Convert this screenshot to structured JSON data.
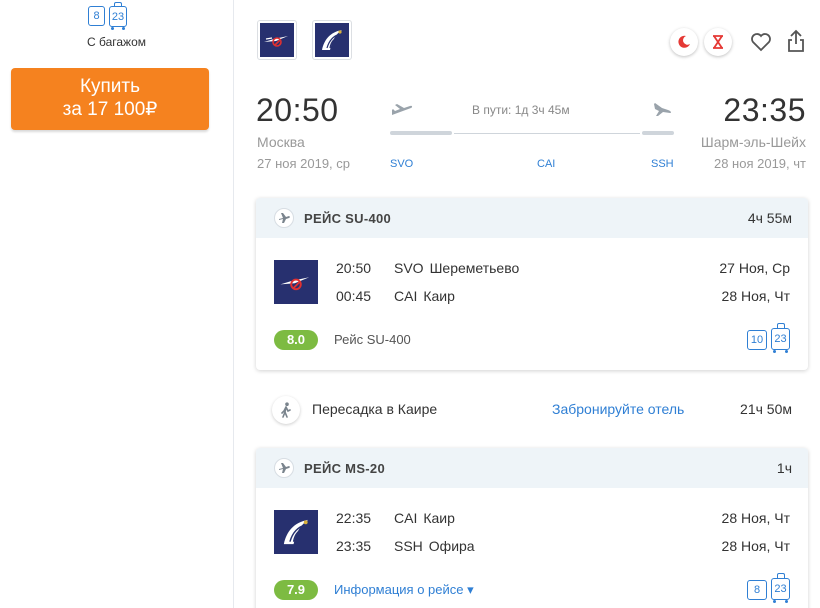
{
  "sidebar": {
    "bag_icons": [
      {
        "value": "8",
        "type": "hand-luggage"
      },
      {
        "value": "23",
        "type": "checked-luggage"
      }
    ],
    "bag_label": "С багажом",
    "buy_line1": "Купить",
    "buy_line2": "за 17 100₽",
    "accent_color": "#f5821f"
  },
  "header": {
    "airline_logos": [
      "aeroflot-logo",
      "egyptair-logo"
    ],
    "icons": [
      "night-flight-icon",
      "long-layover-icon",
      "heart-icon",
      "share-icon"
    ]
  },
  "route": {
    "departure": {
      "time": "20:50",
      "city": "Москва",
      "date": "27 ноя 2019, ср",
      "code": "SVO"
    },
    "arrival": {
      "time": "23:35",
      "city": "Шарм-эль-Шейх",
      "date": "28 ноя 2019, чт",
      "code": "SSH"
    },
    "stop_code": "CAI",
    "duration": "В пути: 1д 3ч 45м"
  },
  "flights": [
    {
      "title": "РЕЙС SU-400",
      "duration": "4ч 55м",
      "logo": "aeroflot-logo",
      "segments": [
        {
          "time": "20:50",
          "code": "SVO",
          "airport": "Шереметьево",
          "date": "27 Ноя, Ср"
        },
        {
          "time": "00:45",
          "code": "CAI",
          "airport": "Каир",
          "date": "28 Ноя, Чт"
        }
      ],
      "rating": "8.0",
      "footer_label": "Рейс SU-400",
      "bags": [
        "10",
        "23"
      ]
    },
    {
      "title": "РЕЙС MS-20",
      "duration": "1ч",
      "logo": "egyptair-logo",
      "segments": [
        {
          "time": "22:35",
          "code": "CAI",
          "airport": "Каир",
          "date": "28 Ноя, Чт"
        },
        {
          "time": "23:35",
          "code": "SSH",
          "airport": "Офира",
          "date": "28 Ноя, Чт"
        }
      ],
      "rating": "7.9",
      "footer_label": "Информация о рейсе ▾",
      "bags": [
        "8",
        "23"
      ]
    }
  ],
  "transfer": {
    "text": "Пересадка в Каире",
    "hotel_link": "Забронируйте отель",
    "duration": "21ч 50м"
  },
  "colors": {
    "link": "#2f7fd4",
    "rating_green": "#7dbb42",
    "logo_navy": "#27306f"
  }
}
